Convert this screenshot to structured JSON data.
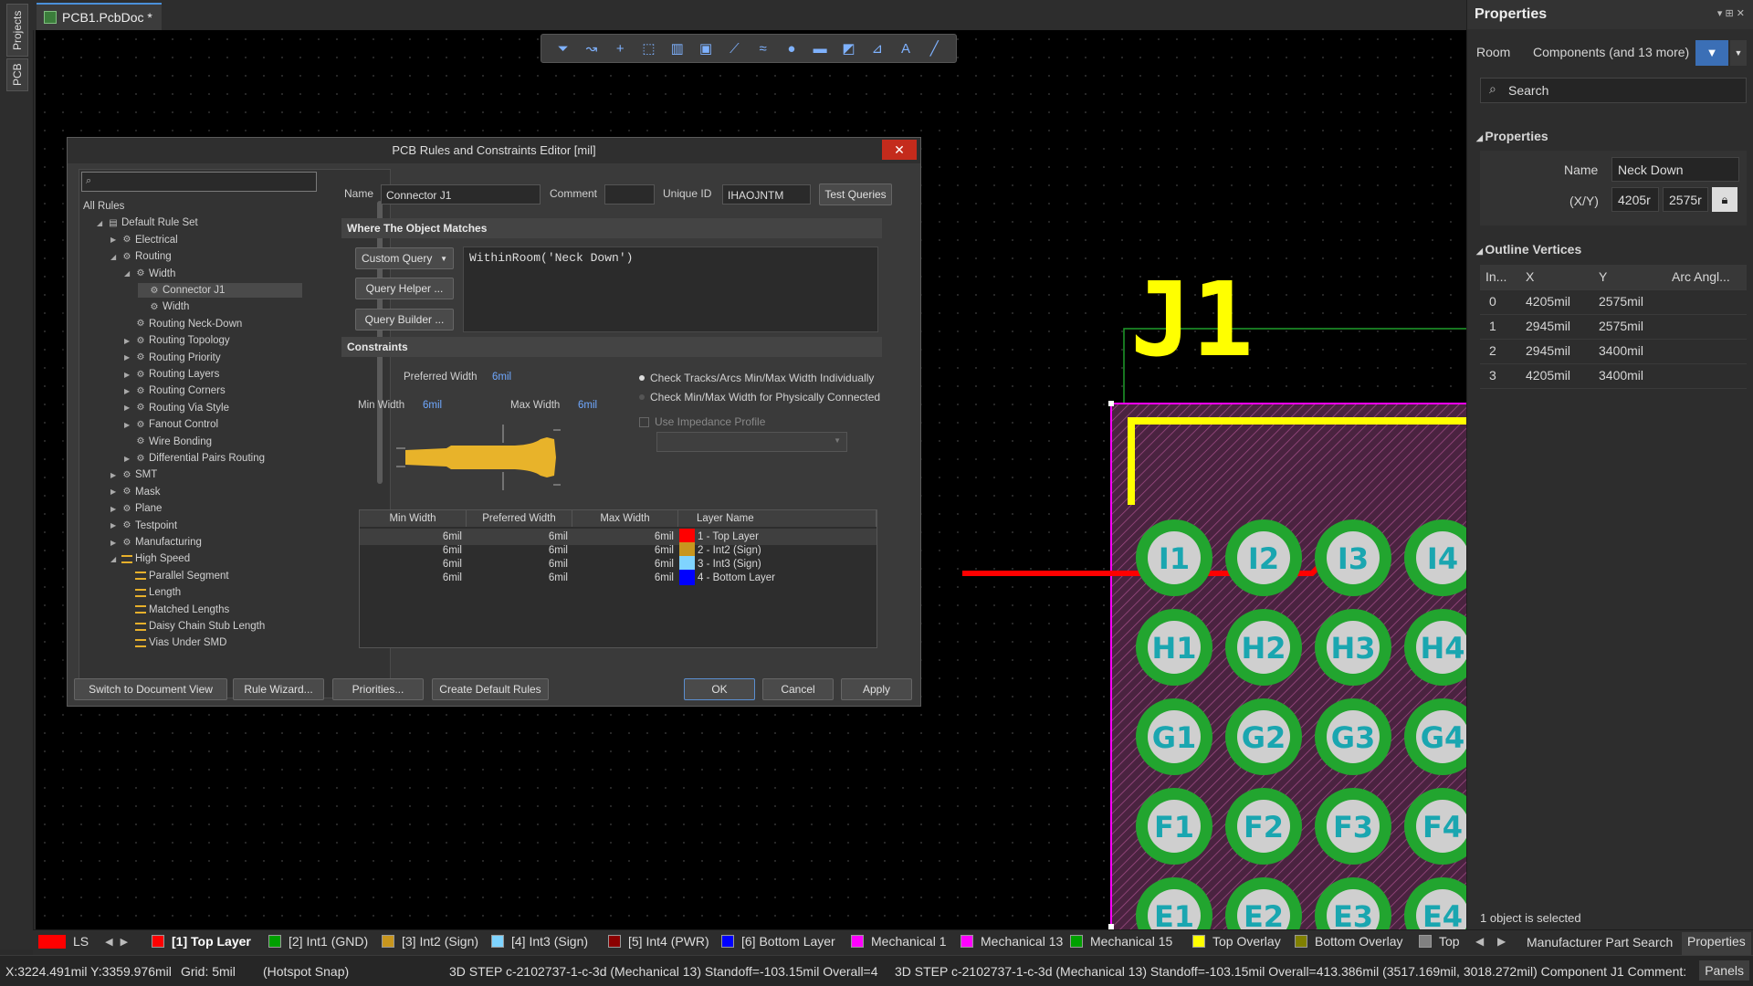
{
  "window": {
    "doc_tab": "PCB1.PcbDoc *",
    "left_tabs": [
      "Projects",
      "PCB"
    ]
  },
  "canvas": {
    "designator": "J1",
    "pads": [
      [
        "I1",
        "I2",
        "I3",
        "I4"
      ],
      [
        "H1",
        "H2",
        "H3",
        "H4"
      ],
      [
        "G1",
        "G2",
        "G3",
        "G4"
      ],
      [
        "F1",
        "F2",
        "F3",
        "F4"
      ],
      [
        "E1",
        "E2",
        "E3",
        "E4"
      ]
    ],
    "colors": {
      "overlay": "#ffff00",
      "pad_ring": "#22a52f",
      "pad_core": "#cfcfcf",
      "pad_text": "#1aa6b0",
      "room": "#ff00ff",
      "track": "#ff0000",
      "board": "#5a2a4a"
    }
  },
  "toolbar": {
    "icons": [
      "filter-icon",
      "route-icon",
      "cross-icon",
      "select-rect-icon",
      "chart-icon",
      "component-icon",
      "interactive-route-icon",
      "diff-pair-icon",
      "pad-icon",
      "fill-icon",
      "polygon-icon",
      "dimension-icon",
      "text-icon",
      "line-icon"
    ]
  },
  "dialog": {
    "title": "PCB Rules and Constraints Editor [mil]",
    "close": "✕",
    "search_placeholder": "",
    "tree": [
      {
        "label": "All Rules",
        "depth": 0,
        "arrow": "",
        "icon": ""
      },
      {
        "label": "Default Rule Set",
        "depth": 1,
        "arrow": "◢",
        "icon": "folder"
      },
      {
        "label": "Electrical",
        "depth": 2,
        "arrow": "▶",
        "icon": "rule"
      },
      {
        "label": "Routing",
        "depth": 2,
        "arrow": "◢",
        "icon": "rule"
      },
      {
        "label": "Width",
        "depth": 3,
        "arrow": "◢",
        "icon": "rule"
      },
      {
        "label": "Connector J1",
        "depth": 4,
        "arrow": "",
        "icon": "rule",
        "selected": true
      },
      {
        "label": "Width",
        "depth": 4,
        "arrow": "",
        "icon": "rule"
      },
      {
        "label": "Routing Neck-Down",
        "depth": 3,
        "arrow": "",
        "icon": "rule"
      },
      {
        "label": "Routing Topology",
        "depth": 3,
        "arrow": "▶",
        "icon": "rule"
      },
      {
        "label": "Routing Priority",
        "depth": 3,
        "arrow": "▶",
        "icon": "rule"
      },
      {
        "label": "Routing Layers",
        "depth": 3,
        "arrow": "▶",
        "icon": "rule"
      },
      {
        "label": "Routing Corners",
        "depth": 3,
        "arrow": "▶",
        "icon": "rule"
      },
      {
        "label": "Routing Via Style",
        "depth": 3,
        "arrow": "▶",
        "icon": "rule"
      },
      {
        "label": "Fanout Control",
        "depth": 3,
        "arrow": "▶",
        "icon": "rule"
      },
      {
        "label": "Wire Bonding",
        "depth": 3,
        "arrow": "",
        "icon": "rule"
      },
      {
        "label": "Differential Pairs Routing",
        "depth": 3,
        "arrow": "▶",
        "icon": "rule"
      },
      {
        "label": "SMT",
        "depth": 2,
        "arrow": "▶",
        "icon": "rule"
      },
      {
        "label": "Mask",
        "depth": 2,
        "arrow": "▶",
        "icon": "rule"
      },
      {
        "label": "Plane",
        "depth": 2,
        "arrow": "▶",
        "icon": "rule"
      },
      {
        "label": "Testpoint",
        "depth": 2,
        "arrow": "▶",
        "icon": "rule"
      },
      {
        "label": "Manufacturing",
        "depth": 2,
        "arrow": "▶",
        "icon": "rule"
      },
      {
        "label": "High Speed",
        "depth": 2,
        "arrow": "◢",
        "icon": "hs"
      },
      {
        "label": "Parallel Segment",
        "depth": 3,
        "arrow": "",
        "icon": "hs"
      },
      {
        "label": "Length",
        "depth": 3,
        "arrow": "",
        "icon": "hs"
      },
      {
        "label": "Matched Lengths",
        "depth": 3,
        "arrow": "",
        "icon": "hs"
      },
      {
        "label": "Daisy Chain Stub Length",
        "depth": 3,
        "arrow": "",
        "icon": "hs"
      },
      {
        "label": "Vias Under SMD",
        "depth": 3,
        "arrow": "",
        "icon": "hs"
      }
    ],
    "name_label": "Name",
    "name_value": "Connector J1",
    "comment_label": "Comment",
    "comment_value": "",
    "uid_label": "Unique ID",
    "uid_value": "IHAOJNTM",
    "test_queries": "Test Queries",
    "where_head": "Where The Object Matches",
    "query_type": "Custom Query",
    "query_helper": "Query Helper ...",
    "query_builder": "Query Builder ...",
    "query_text": "WithinRoom('Neck Down')",
    "constraints_head": "Constraints",
    "preferred_width_label": "Preferred Width",
    "preferred_width_value": "6mil",
    "min_width_label": "Min Width",
    "min_width_value": "6mil",
    "max_width_label": "Max Width",
    "max_width_value": "6mil",
    "radio1": "Check Tracks/Arcs Min/Max Width Individually",
    "radio2": "Check Min/Max Width for Physically Connected",
    "impedance": "Use Impedance Profile",
    "table_headers": [
      "Min Width",
      "Preferred Width",
      "Max Width",
      "Layer Name"
    ],
    "table_rows": [
      {
        "min": "6mil",
        "pref": "6mil",
        "max": "6mil",
        "color": "#ff0000",
        "layer": "1 - Top Layer"
      },
      {
        "min": "6mil",
        "pref": "6mil",
        "max": "6mil",
        "color": "#c8961e",
        "layer": "2 - Int2 (Sign)"
      },
      {
        "min": "6mil",
        "pref": "6mil",
        "max": "6mil",
        "color": "#7fd4ff",
        "layer": "3 - Int3 (Sign)"
      },
      {
        "min": "6mil",
        "pref": "6mil",
        "max": "6mil",
        "color": "#0000ff",
        "layer": "4 - Bottom Layer"
      }
    ],
    "btn_switch": "Switch to Document View",
    "btn_wizard": "Rule Wizard...",
    "btn_priorities": "Priorities...",
    "btn_defaults": "Create Default Rules",
    "btn_ok": "OK",
    "btn_cancel": "Cancel",
    "btn_apply": "Apply"
  },
  "properties": {
    "title": "Properties",
    "room_label": "Room",
    "components_label": "Components (and 13 more)",
    "search_placeholder": "Search",
    "props_head": "Properties",
    "name_label": "Name",
    "name_value": "Neck Down",
    "xy_label": "(X/Y)",
    "x_value": "4205r",
    "y_value": "2575r",
    "vertices_head": "Outline Vertices",
    "vertex_headers": [
      "In...",
      "X",
      "Y",
      "Arc Angl..."
    ],
    "vertices": [
      {
        "i": "0",
        "x": "4205mil",
        "y": "2575mil"
      },
      {
        "i": "1",
        "x": "2945mil",
        "y": "2575mil"
      },
      {
        "i": "2",
        "x": "2945mil",
        "y": "3400mil"
      },
      {
        "i": "3",
        "x": "4205mil",
        "y": "3400mil"
      }
    ],
    "selected_text": "1 object is selected"
  },
  "layers": [
    {
      "label": "LS",
      "color": "#ff0000"
    },
    {
      "label": "[1] Top Layer",
      "color": "#ff0000",
      "active": true
    },
    {
      "label": "[2] Int1 (GND)",
      "color": "#00a000"
    },
    {
      "label": "[3] Int2 (Sign)",
      "color": "#c8961e"
    },
    {
      "label": "[4] Int3 (Sign)",
      "color": "#7fd4ff"
    },
    {
      "label": "[5] Int4 (PWR)",
      "color": "#8b0000"
    },
    {
      "label": "[6] Bottom Layer",
      "color": "#0000ff"
    },
    {
      "label": "Mechanical 1",
      "color": "#ff00ff"
    },
    {
      "label": "Mechanical 13",
      "color": "#ff00ff"
    },
    {
      "label": "Mechanical 15",
      "color": "#00a000"
    },
    {
      "label": "Top Overlay",
      "color": "#ffff00"
    },
    {
      "label": "Bottom Overlay",
      "color": "#808000"
    },
    {
      "label": "Top",
      "color": "#808080"
    }
  ],
  "right_tabs": [
    "Manufacturer Part Search",
    "Properties"
  ],
  "status": {
    "coords": "X:3224.491mil Y:3359.976mil",
    "grid": "Grid: 5mil",
    "snap": "(Hotspot Snap)",
    "step1": "3D STEP c-2102737-1-c-3d (Mechanical 13)  Standoff=-103.15mil  Overall=4",
    "step2": "3D STEP c-2102737-1-c-3d (Mechanical 13)  Standoff=-103.15mil  Overall=413.386mil  (3517.169mil, 3018.272mil)  Component J1 Comment:",
    "panels": "Panels"
  }
}
